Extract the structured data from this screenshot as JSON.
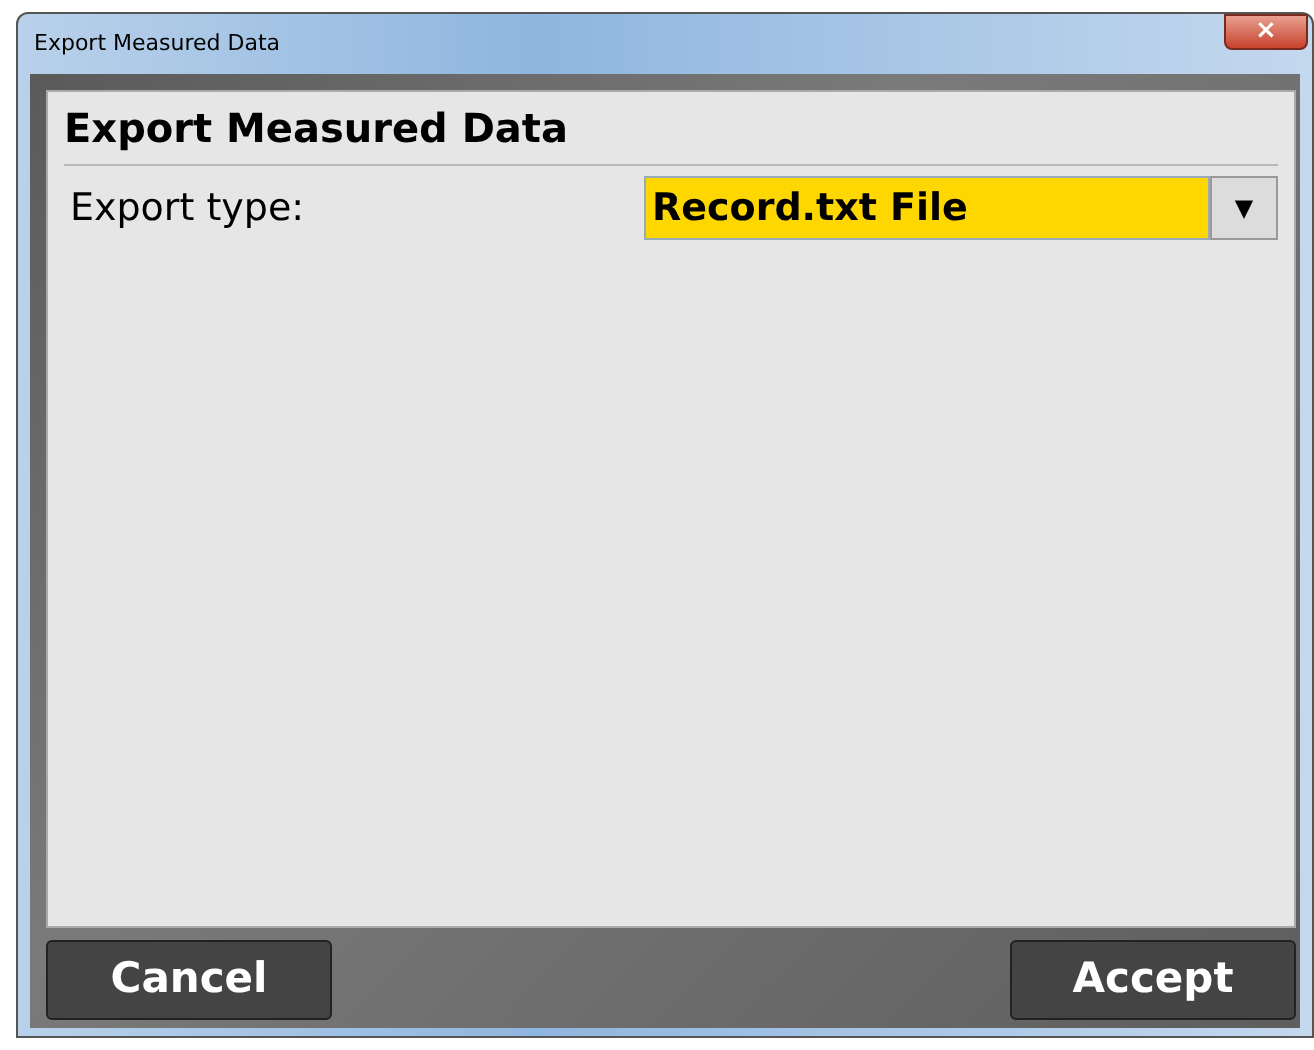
{
  "window": {
    "title": "Export Measured Data",
    "close": "×"
  },
  "panel": {
    "heading": "Export Measured Data",
    "fields": [
      {
        "label": "Export type:",
        "value": "Record.txt File",
        "arrow": "▼"
      }
    ]
  },
  "buttons": [
    {
      "label": "Cancel"
    },
    {
      "label": "Accept"
    }
  ]
}
